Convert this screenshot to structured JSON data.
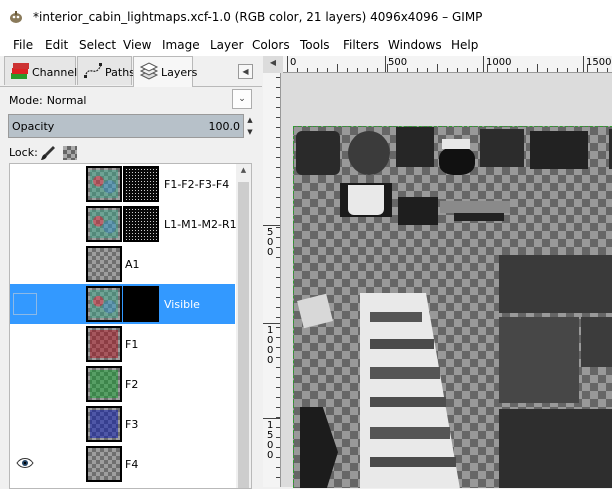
{
  "window": {
    "title": "*interior_cabin_lightmaps.xcf-1.0 (RGB color, 21 layers) 4096x4096 – GIMP"
  },
  "menu": [
    "File",
    "Edit",
    "Select",
    "View",
    "Image",
    "Layer",
    "Colors",
    "Tools",
    "Filters",
    "Windows",
    "Help"
  ],
  "dock": {
    "tabs": [
      {
        "label": "Channels",
        "icon": "channels-icon",
        "active": false
      },
      {
        "label": "Paths",
        "icon": "paths-icon",
        "active": false
      },
      {
        "label": "Layers",
        "icon": "layers-icon",
        "active": true
      }
    ],
    "mode_label": "Mode:",
    "mode_value": "Normal",
    "opacity_label": "Opacity",
    "opacity_value": "100.0",
    "lock_label": "Lock:"
  },
  "layers": [
    {
      "name": "F1-F2-F3-F4",
      "visible": false,
      "selected": false,
      "mask": "dotted",
      "tint": "mix"
    },
    {
      "name": "L1-M1-M2-R1",
      "visible": false,
      "selected": false,
      "mask": "dotted",
      "tint": "mix"
    },
    {
      "name": "A1",
      "visible": false,
      "selected": false,
      "mask": "none",
      "tint": "none"
    },
    {
      "name": "Visible",
      "visible": false,
      "selected": true,
      "mask": "solid",
      "tint": "mix"
    },
    {
      "name": "F1",
      "visible": false,
      "selected": false,
      "mask": "none",
      "tint": "red"
    },
    {
      "name": "F2",
      "visible": false,
      "selected": false,
      "mask": "none",
      "tint": "green"
    },
    {
      "name": "F3",
      "visible": false,
      "selected": false,
      "mask": "none",
      "tint": "blue"
    },
    {
      "name": "F4",
      "visible": true,
      "selected": false,
      "mask": "none",
      "tint": "none"
    }
  ],
  "rulers": {
    "horizontal": [
      "0",
      "500",
      "1000",
      "1500"
    ],
    "vertical": [
      "500",
      "1000",
      "1500"
    ]
  }
}
